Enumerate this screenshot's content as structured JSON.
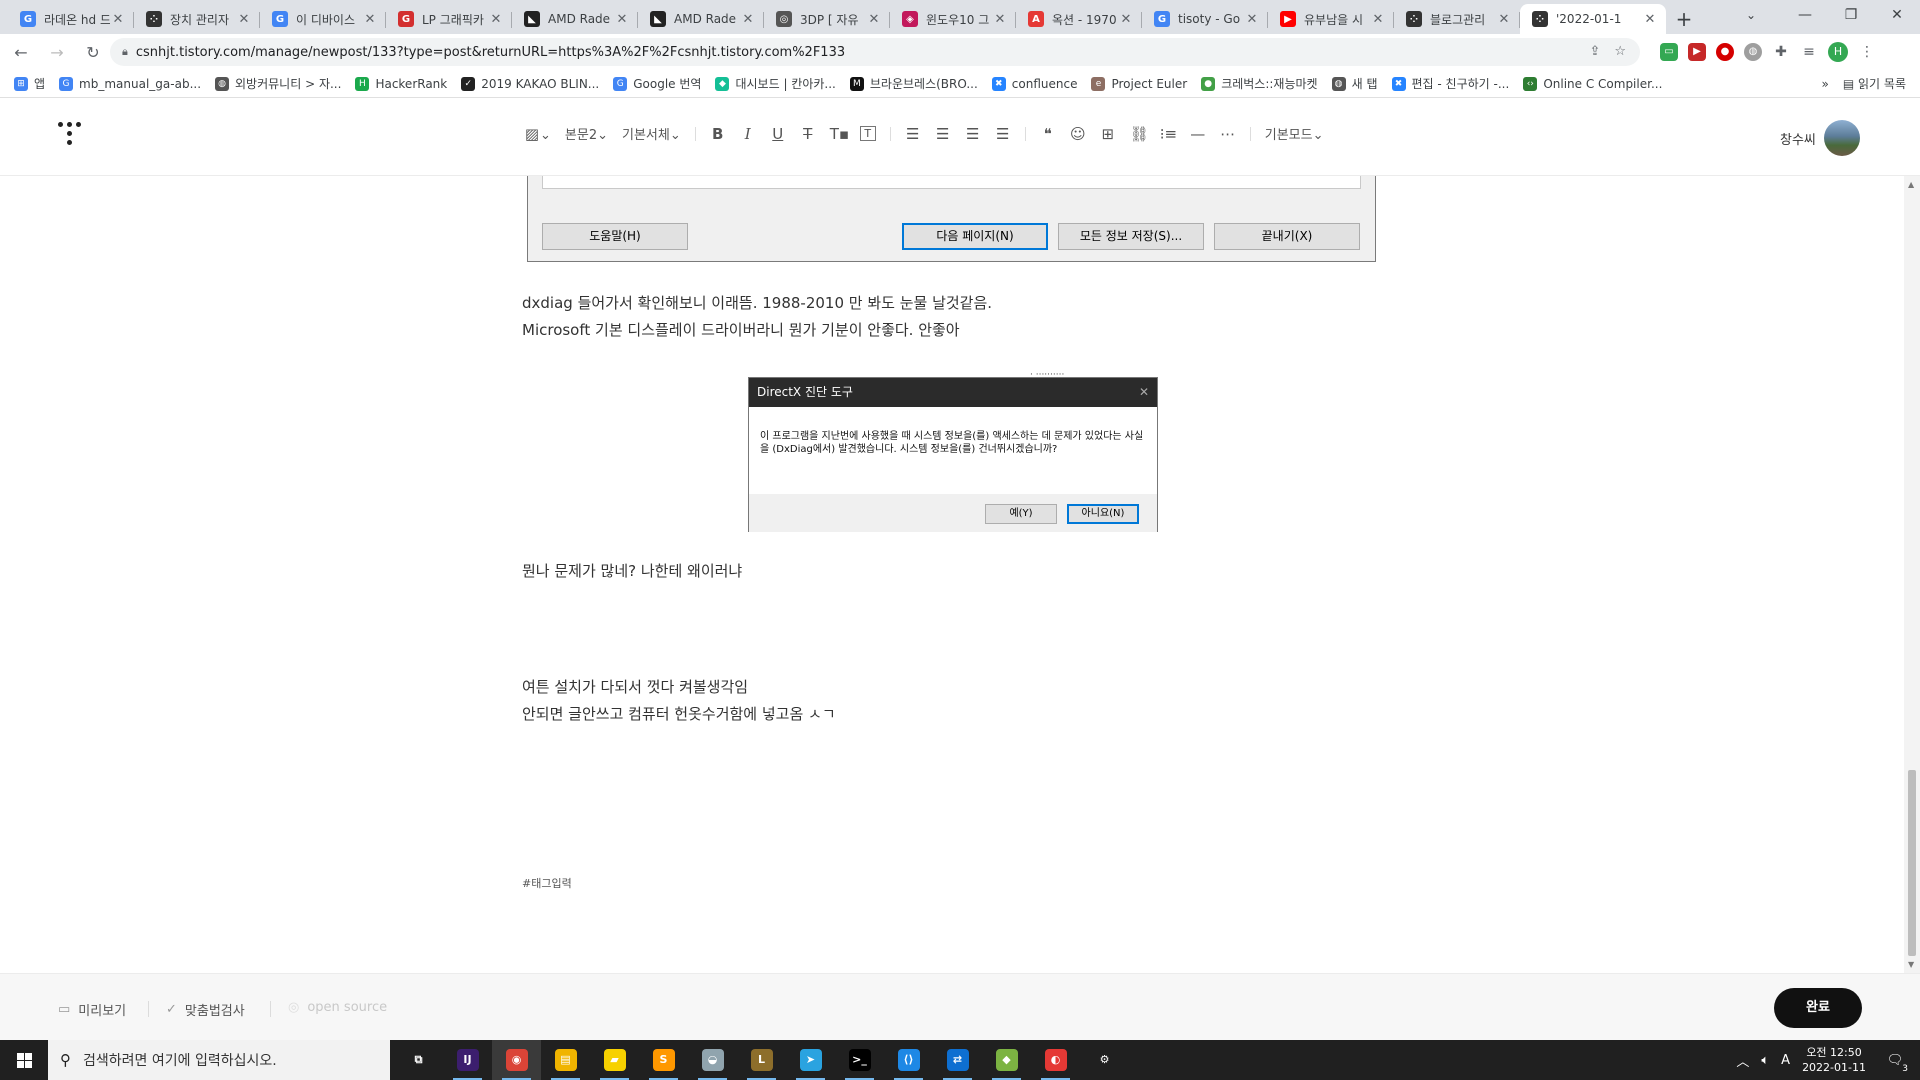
{
  "browser": {
    "tabs": [
      {
        "title": "라데온 hd 드",
        "icon": "google-icon",
        "color": "#4285f4",
        "glyph": "G"
      },
      {
        "title": "장치 관리자",
        "icon": "tistory-icon",
        "color": "#333333",
        "glyph": "⁘"
      },
      {
        "title": "이 디바이스",
        "icon": "google-icon",
        "color": "#4285f4",
        "glyph": "G"
      },
      {
        "title": "LP 그래픽카",
        "icon": "red-g-icon",
        "color": "#d32f2f",
        "glyph": "G"
      },
      {
        "title": "AMD Rade",
        "icon": "amd-icon",
        "color": "#222222",
        "glyph": "◣"
      },
      {
        "title": "AMD Rade",
        "icon": "amd-icon",
        "color": "#222222",
        "glyph": "◣"
      },
      {
        "title": "3DP [ 자유",
        "icon": "3dp-icon",
        "color": "#555555",
        "glyph": "◎"
      },
      {
        "title": "윈도우10 그",
        "icon": "naver-blog-icon",
        "color": "#c2185b",
        "glyph": "◈"
      },
      {
        "title": "옥션 - 1970",
        "icon": "auction-icon",
        "color": "#e53935",
        "glyph": "A"
      },
      {
        "title": "tisoty - Go",
        "icon": "google-icon",
        "color": "#4285f4",
        "glyph": "G"
      },
      {
        "title": "유부남을 시",
        "icon": "youtube-icon",
        "color": "#ff0000",
        "glyph": "▶"
      },
      {
        "title": "블로그관리",
        "icon": "tistory-icon",
        "color": "#333333",
        "glyph": "⁘"
      },
      {
        "title": "'2022-01-1",
        "icon": "tistory-icon",
        "color": "#333333",
        "glyph": "⁘"
      }
    ],
    "close_glyph": "✕",
    "new_tab_glyph": "+",
    "window_controls": [
      "⌄",
      "—",
      "❐",
      "✕"
    ],
    "url": "csnhjt.tistory.com/manage/newpost/133?type=post&returnURL=https%3A%2F%2Fcsnhjt.tistory.com%2F133",
    "profile_initial": "H",
    "bookmarks": [
      {
        "label": "앱",
        "color": "#4285f4",
        "glyph": "⊞"
      },
      {
        "label": "mb_manual_ga-ab...",
        "color": "#4285f4",
        "glyph": "G"
      },
      {
        "label": "외방커뮤니티 > 자...",
        "color": "#555555",
        "glyph": "◍"
      },
      {
        "label": "HackerRank",
        "color": "#1ba94c",
        "glyph": "H"
      },
      {
        "label": "2019 KAKAO BLIN...",
        "color": "#222222",
        "glyph": "✓"
      },
      {
        "label": "Google 번역",
        "color": "#4285f4",
        "glyph": "G"
      },
      {
        "label": "대시보드 | 칸아카...",
        "color": "#14bf96",
        "glyph": "◆"
      },
      {
        "label": "브라운브레스(BRO...",
        "color": "#111111",
        "glyph": "M"
      },
      {
        "label": "confluence",
        "color": "#2684ff",
        "glyph": "✖"
      },
      {
        "label": "Project Euler",
        "color": "#8d6e63",
        "glyph": "e"
      },
      {
        "label": "크레벅스::재능마켓",
        "color": "#43a047",
        "glyph": "●"
      },
      {
        "label": "새 탭",
        "color": "#555555",
        "glyph": "◍"
      },
      {
        "label": "편집 - 친구하기 -...",
        "color": "#2684ff",
        "glyph": "✖"
      },
      {
        "label": "Online C Compiler...",
        "color": "#2e7d32",
        "glyph": "‹›"
      }
    ],
    "reading_list": "읽기 목록"
  },
  "editor": {
    "toolbar": {
      "image_btn": "🖼",
      "paragraph_style": "본문2",
      "font": "기본서체",
      "mode": "기본모드"
    },
    "user_name": "창수씨",
    "content": {
      "wizard_buttons": {
        "help": "도움말(H)",
        "next": "다음 페이지(N)",
        "save_all": "모든 정보 저장(S)...",
        "exit": "끝내기(X)"
      },
      "para1_line1": "dxdiag 들어가서 확인해보니 이래뜸. 1988-2010 만 봐도 눈물 날것같음.",
      "para1_line2": "Microsoft 기본 디스플레이 드라이버라니 뭔가 기분이 안좋다. 안좋아",
      "dialog": {
        "title": "DirectX 진단 도구",
        "message": "이 프로그램을 지난번에 사용했을 때 시스템 정보을(를) 액세스하는 데 문제가 있었다는 사실을 (DxDiag에서) 발견했습니다. 시스템 정보을(를) 건너뛰시겠습니까?",
        "yes": "예(Y)",
        "no": "아니요(N)"
      },
      "para2": "뭔나 문제가 많네? 나한테 왜이러냐",
      "para3_line1": "여튼 설치가 다되서 껏다 켜볼생각임",
      "para3_line2": "안되면 글안쓰고 컴퓨터 헌옷수거함에 넣고옴 ㅅㄱ",
      "tag_placeholder": "#태그입력"
    },
    "bottom": {
      "preview": "미리보기",
      "spellcheck": "맞춤법검사",
      "open_source": "open source",
      "done": "완료"
    }
  },
  "taskbar": {
    "search_placeholder": "검색하려면 여기에 입력하십시오.",
    "apps": [
      {
        "name": "task-view",
        "color": "#202020",
        "glyph": "⧉"
      },
      {
        "name": "intellij",
        "color": "#3c1e6e",
        "glyph": "IJ"
      },
      {
        "name": "chrome",
        "color": "#db4437",
        "glyph": "◉"
      },
      {
        "name": "file-explorer",
        "color": "#f0b400",
        "glyph": "▤"
      },
      {
        "name": "sticky-notes",
        "color": "#f7d100",
        "glyph": "▰"
      },
      {
        "name": "sublime-text",
        "color": "#ff9800",
        "glyph": "S"
      },
      {
        "name": "world-app",
        "color": "#90a4ae",
        "glyph": "◒"
      },
      {
        "name": "league-of-legends",
        "color": "#8d6e2b",
        "glyph": "L"
      },
      {
        "name": "telegram",
        "color": "#2aa3e0",
        "glyph": "➤"
      },
      {
        "name": "terminal",
        "color": "#000000",
        "glyph": ">_"
      },
      {
        "name": "vscode",
        "color": "#1e88e5",
        "glyph": "⟨⟩"
      },
      {
        "name": "teamviewer",
        "color": "#0e6fd1",
        "glyph": "⇄"
      },
      {
        "name": "winrar",
        "color": "#7cb342",
        "glyph": "◆"
      },
      {
        "name": "red-app",
        "color": "#e53935",
        "glyph": "◐"
      },
      {
        "name": "settings",
        "color": "#202020",
        "glyph": "⚙"
      }
    ],
    "ime": "A",
    "time": "오전 12:50",
    "date": "2022-01-11",
    "notification_count": "3"
  }
}
